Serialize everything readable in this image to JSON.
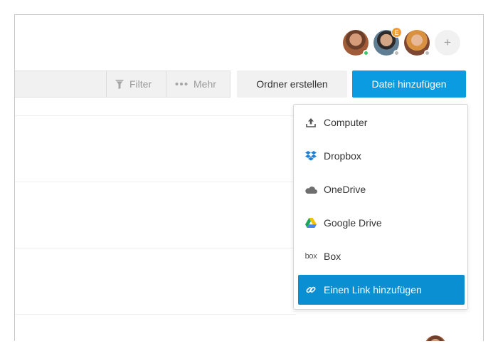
{
  "header": {
    "avatars": [
      {
        "status_color": "#3ec46d"
      },
      {
        "status_color": "#bdbdbd",
        "badge": "E"
      },
      {
        "status_color": "#bdbdbd"
      }
    ],
    "add_member_label": "+"
  },
  "toolbar": {
    "filter_label": "Filter",
    "more_label": "Mehr",
    "create_folder_label": "Ordner erstellen",
    "add_file_label": "Datei hinzufügen"
  },
  "dropdown": {
    "items": [
      {
        "label": "Computer",
        "icon": "upload-icon"
      },
      {
        "label": "Dropbox",
        "icon": "dropbox-icon"
      },
      {
        "label": "OneDrive",
        "icon": "onedrive-icon"
      },
      {
        "label": "Google Drive",
        "icon": "google-drive-icon"
      },
      {
        "label": "Box",
        "icon": "box-icon",
        "icon_text": "box"
      },
      {
        "label": "Einen Link hinzufügen",
        "icon": "link-icon",
        "highlighted": true
      }
    ]
  },
  "colors": {
    "primary": "#0a9be0",
    "highlight": "#0a8fd2",
    "online": "#3ec46d",
    "badge": "#f0a030"
  }
}
